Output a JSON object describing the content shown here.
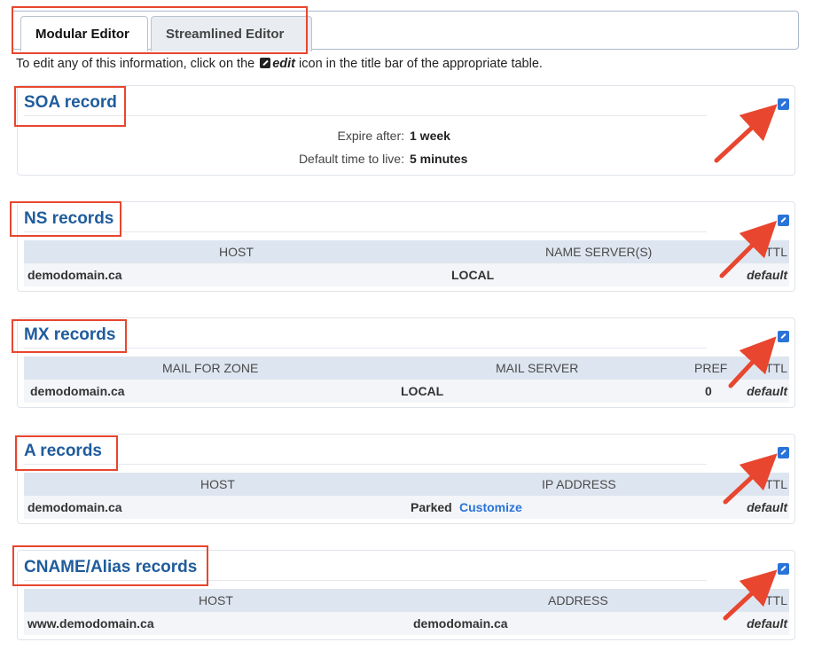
{
  "tabs": {
    "modular": "Modular Editor",
    "streamlined": "Streamlined Editor"
  },
  "intro": {
    "before": "To edit any of this information, click on the",
    "edit_word": "edit",
    "after": "icon in the title bar of the appropriate table."
  },
  "soa": {
    "title": "SOA record",
    "expire_label": "Expire after:",
    "expire_value": "1 week",
    "ttl_label": "Default time to live:",
    "ttl_value": "5 minutes"
  },
  "ns": {
    "title": "NS records",
    "headers": [
      "HOST",
      "NAME SERVER(S)",
      "TTL"
    ],
    "row": {
      "host": "demodomain.ca",
      "server": "LOCAL",
      "ttl": "default"
    }
  },
  "mx": {
    "title": "MX records",
    "headers": [
      "MAIL FOR ZONE",
      "MAIL SERVER",
      "PREF",
      "TTL"
    ],
    "row": {
      "zone": "demodomain.ca",
      "server": "LOCAL",
      "pref": "0",
      "ttl": "default"
    }
  },
  "a": {
    "title": "A records",
    "headers": [
      "HOST",
      "IP ADDRESS",
      "TTL"
    ],
    "row": {
      "host": "demodomain.ca",
      "ip": "Parked",
      "customize": "Customize",
      "ttl": "default"
    }
  },
  "cname": {
    "title": "CNAME/Alias records",
    "headers": [
      "HOST",
      "ADDRESS",
      "TTL"
    ],
    "row": {
      "host": "www.demodomain.ca",
      "address": "demodomain.ca",
      "ttl": "default"
    }
  },
  "colors": {
    "title_blue": "#1f5c9c",
    "edit_blue": "#2a73d9",
    "annotation_red": "#e8462f"
  },
  "icons": [
    "edit-icon",
    "annotation-arrow"
  ]
}
